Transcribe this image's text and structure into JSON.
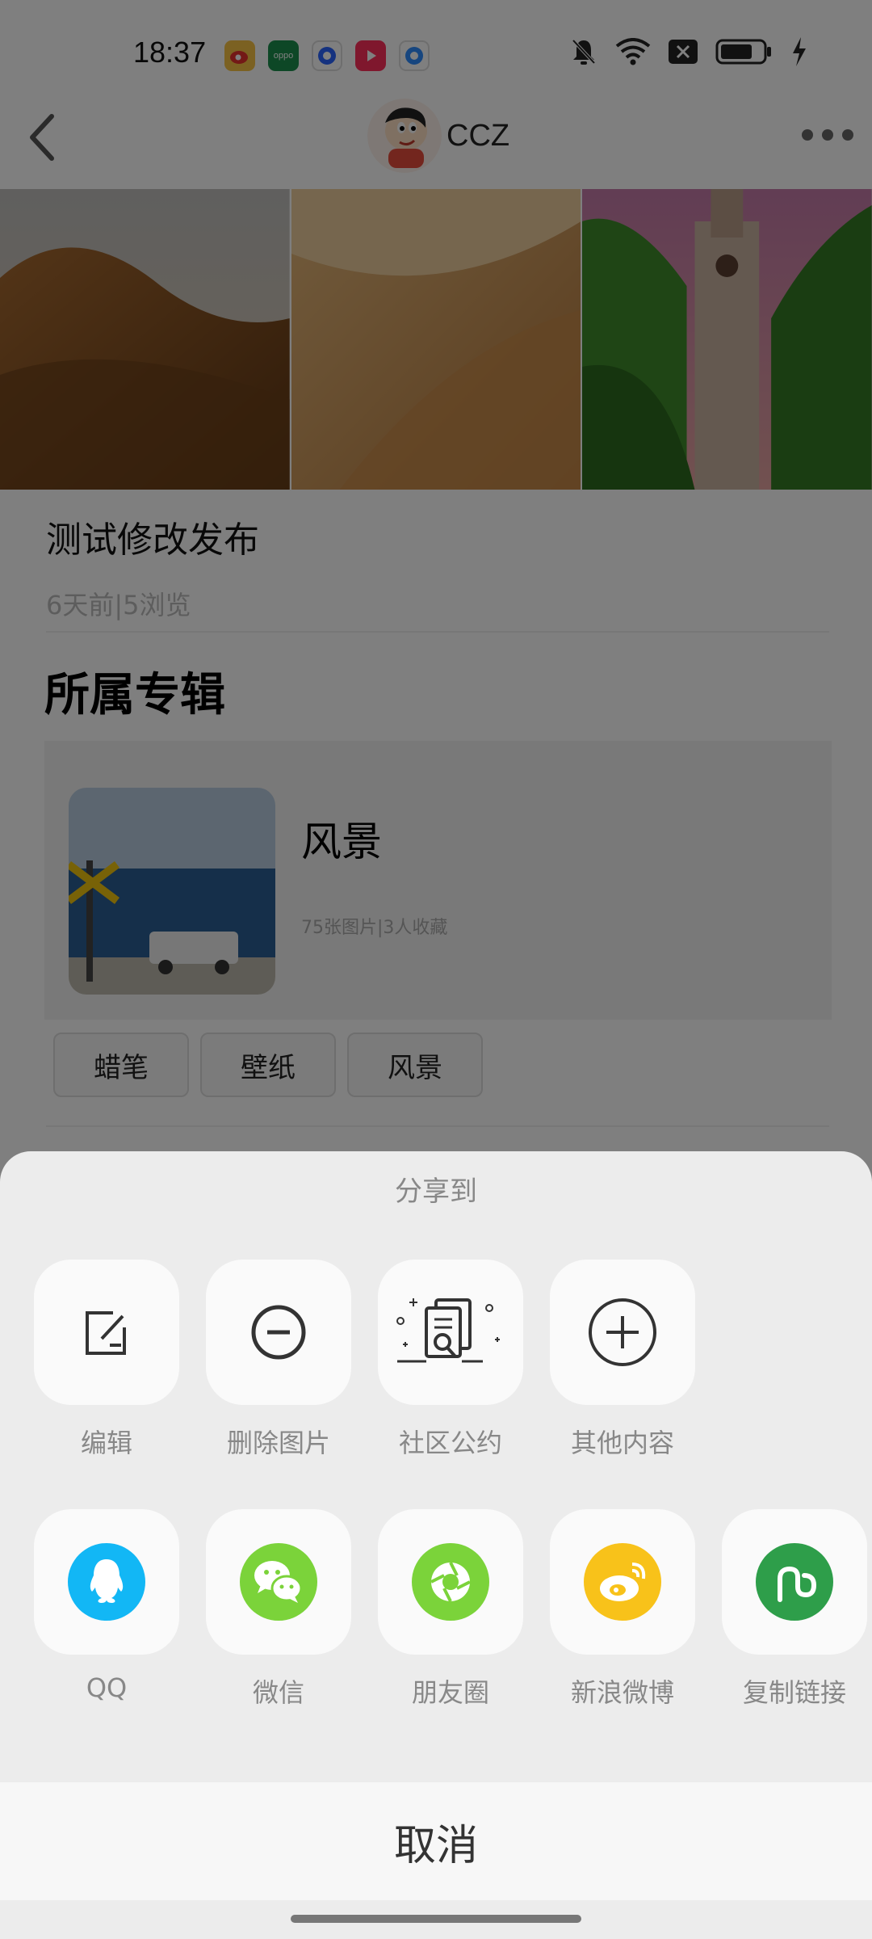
{
  "status": {
    "time": "18:37",
    "apps": [
      {
        "name": "weibo-app-icon",
        "color": "#f6c244",
        "label": ""
      },
      {
        "name": "oppo-app-icon",
        "color": "#1a8f4c",
        "label": "oppo"
      },
      {
        "name": "blue-app-icon",
        "color": "#2a64ff",
        "label": ""
      },
      {
        "name": "video-app-icon",
        "color": "#ff2f5a",
        "label": ""
      },
      {
        "name": "browser-app-icon",
        "color": "#2e8cff",
        "label": ""
      }
    ]
  },
  "header": {
    "author_name": "CCZ"
  },
  "post": {
    "title": "测试修改发布",
    "meta": "6天前|5浏览"
  },
  "album_section": {
    "title": "所属专辑",
    "album_name": "风景",
    "album_meta": "75张图片|3人收藏"
  },
  "tags": [
    "蜡笔",
    "壁纸",
    "风景"
  ],
  "share_sheet": {
    "title": "分享到",
    "actions": [
      {
        "label": "编辑",
        "icon": "edit-icon"
      },
      {
        "label": "删除图片",
        "icon": "remove-circle-icon"
      },
      {
        "label": "社区公约",
        "icon": "document-search-icon"
      },
      {
        "label": "其他内容",
        "icon": "add-circle-icon"
      }
    ],
    "targets": [
      {
        "label": "QQ",
        "icon": "qq-icon",
        "color": "#12b7f5"
      },
      {
        "label": "微信",
        "icon": "wechat-icon",
        "color": "#7bd33a"
      },
      {
        "label": "朋友圈",
        "icon": "moments-icon",
        "color": "#7bd33a"
      },
      {
        "label": "新浪微博",
        "icon": "weibo-icon",
        "color": "#f8c21a"
      },
      {
        "label": "复制链接",
        "icon": "link-icon",
        "color": "#2e9e4a"
      }
    ],
    "cancel_label": "取消"
  }
}
